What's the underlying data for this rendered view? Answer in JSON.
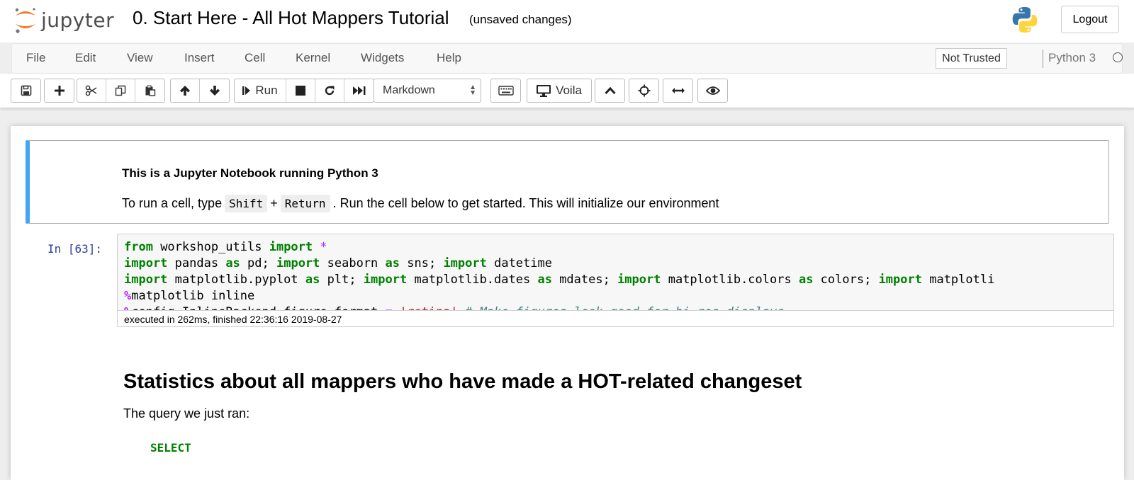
{
  "header": {
    "logo_text": "jupyter",
    "notebook_title": "0. Start Here - All Hot Mappers Tutorial",
    "save_status": "(unsaved changes)",
    "logout_label": "Logout"
  },
  "menubar": {
    "items": [
      "File",
      "Edit",
      "View",
      "Insert",
      "Cell",
      "Kernel",
      "Widgets",
      "Help"
    ],
    "trust_label": "Not Trusted",
    "kernel_name": "Python 3"
  },
  "toolbar": {
    "run_label": "Run",
    "cell_type": "Markdown",
    "voila_label": "Voila",
    "icons": [
      "save-icon",
      "plus-icon",
      "cut-icon",
      "copy-icon",
      "paste-icon",
      "arrow-up-icon",
      "arrow-down-icon",
      "step-forward-icon",
      "stop-icon",
      "restart-icon",
      "fast-forward-icon",
      "keyboard-icon",
      "desktop-icon",
      "chevron-up-icon",
      "crosshairs-icon",
      "arrows-h-icon",
      "eye-icon"
    ]
  },
  "cells": {
    "markdown": {
      "title": "This is a Jupyter Notebook running Python 3",
      "text_before": "To run a cell, type",
      "key1": "Shift",
      "plus": "+",
      "key2": "Return",
      "text_after": ". Run the cell below to get started. This will initialize our environment"
    },
    "code": {
      "prompt": "In [63]:",
      "line1": {
        "kw1": "from",
        "t1": " workshop_utils ",
        "kw2": "import",
        "op": " *"
      },
      "line2": {
        "kw1": "import",
        "t1": " pandas ",
        "kw2": "as",
        "t2": " pd; ",
        "kw3": "import",
        "t3": " seaborn ",
        "kw4": "as",
        "t4": " sns; ",
        "kw5": "import",
        "t5": " datetime"
      },
      "line3": {
        "kw1": "import",
        "t1": " matplotlib.pyplot ",
        "kw2": "as",
        "t2": " plt; ",
        "kw3": "import",
        "t3": " matplotlib.dates ",
        "kw4": "as",
        "t4": " mdates; ",
        "kw5": "import",
        "t5": " matplotlib.colors ",
        "kw6": "as",
        "t6": " colors; ",
        "kw7": "import",
        "t7": " matplotli"
      },
      "line4": {
        "op": "%",
        "t": "matplotlib inline"
      },
      "line5": {
        "op": "%",
        "t1": "config InlineBackend.figure_format ",
        "eq": "=",
        "sp": " ",
        "str": "'retina'",
        "cm": " # Make figures look good for hi-res displays."
      },
      "exec_info": "executed in 262ms, finished 22:36:16 2019-08-27"
    },
    "heading": "Statistics about all mappers who have made a HOT-related changeset",
    "paragraph": "The query we just ran:",
    "sql_keyword": "SELECT"
  },
  "colors": {
    "accent_blue": "#42a5f5",
    "prompt_blue": "#303f9f",
    "keyword_green": "#008000",
    "operator_purple": "#aa22ff",
    "string_red": "#ba2121",
    "comment_teal": "#408080",
    "jupyter_orange": "#f37626"
  }
}
